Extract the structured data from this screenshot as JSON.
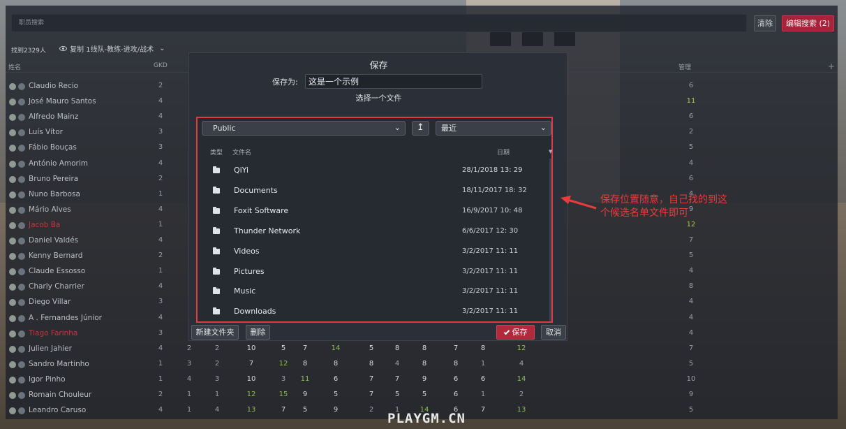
{
  "toolbar": {
    "search_placeholder": "职员搜索",
    "clear_label": "清除",
    "edit_search_label": "编辑搜索 (2)"
  },
  "results": {
    "found_text": "找到2329人",
    "view_label": "复制 1线队-教练-进攻/战术"
  },
  "table": {
    "col_name": "姓名",
    "col_gkd": "GKD",
    "col_manage": "管理",
    "rows": [
      {
        "name": "Claudio Recio",
        "color": "normal",
        "cells": [
          "2"
        ],
        "manage": "6",
        "manage_hl": false
      },
      {
        "name": "José Mauro Santos",
        "color": "normal",
        "cells": [
          "4"
        ],
        "manage": "11",
        "manage_hl": true
      },
      {
        "name": "Alfredo Mainz",
        "color": "normal",
        "cells": [
          "4"
        ],
        "manage": "6",
        "manage_hl": false
      },
      {
        "name": "Luís Vítor",
        "color": "normal",
        "cells": [
          "3"
        ],
        "manage": "2",
        "manage_hl": false
      },
      {
        "name": "Fábio Bouças",
        "color": "normal",
        "cells": [
          "3"
        ],
        "manage": "5",
        "manage_hl": false
      },
      {
        "name": "António Amorim",
        "color": "normal",
        "cells": [
          "4"
        ],
        "manage": "4",
        "manage_hl": false
      },
      {
        "name": "Bruno Pereira",
        "color": "normal",
        "cells": [
          "2"
        ],
        "manage": "6",
        "manage_hl": false
      },
      {
        "name": "Nuno Barbosa",
        "color": "normal",
        "cells": [
          "1"
        ],
        "manage": "4",
        "manage_hl": false
      },
      {
        "name": "Mário Alves",
        "color": "normal",
        "cells": [
          "4"
        ],
        "manage": "9",
        "manage_hl": false
      },
      {
        "name": "Jacob Ba",
        "color": "red",
        "cells": [
          "1"
        ],
        "manage": "12",
        "manage_hl": true
      },
      {
        "name": "Daniel Valdés",
        "color": "normal",
        "cells": [
          "4"
        ],
        "manage": "7",
        "manage_hl": false
      },
      {
        "name": "Kenny Bernard",
        "color": "normal",
        "cells": [
          "2"
        ],
        "manage": "5",
        "manage_hl": false
      },
      {
        "name": "Claude Essosso",
        "color": "normal",
        "cells": [
          "1"
        ],
        "manage": "4",
        "manage_hl": false
      },
      {
        "name": "Charly Charrier",
        "color": "normal",
        "cells": [
          "4"
        ],
        "manage": "8",
        "manage_hl": false
      },
      {
        "name": "Diego Villar",
        "color": "normal",
        "cells": [
          "3"
        ],
        "manage": "4",
        "manage_hl": false
      },
      {
        "name": "A . Fernandes Júnior",
        "color": "normal",
        "cells": [
          "4"
        ],
        "manage": "4",
        "manage_hl": false
      },
      {
        "name": "Tiago Farinha",
        "color": "red",
        "cells": [
          "3"
        ],
        "manage": "4",
        "manage_hl": false
      }
    ],
    "full_rows": [
      {
        "name": "Julien Jahier",
        "cells": [
          "4",
          "2",
          "2",
          "10",
          "5",
          "7",
          "14",
          "5",
          "8",
          "8",
          "7",
          "8",
          "12"
        ],
        "manage": "7"
      },
      {
        "name": "Sandro Martinho",
        "cells": [
          "1",
          "3",
          "2",
          "7",
          "12",
          "8",
          "8",
          "8",
          "4",
          "8",
          "8",
          "1",
          "4"
        ],
        "manage": "5"
      },
      {
        "name": "Igor Pinho",
        "cells": [
          "1",
          "4",
          "3",
          "10",
          "3",
          "11",
          "6",
          "7",
          "7",
          "9",
          "6",
          "6",
          "14"
        ],
        "manage": "10"
      },
      {
        "name": "Romain Chouleur",
        "cells": [
          "2",
          "1",
          "1",
          "12",
          "15",
          "9",
          "5",
          "7",
          "5",
          "5",
          "6",
          "1",
          "2"
        ],
        "manage": "9"
      },
      {
        "name": "Leandro Caruso",
        "cells": [
          "4",
          "1",
          "4",
          "13",
          "7",
          "5",
          "9",
          "2",
          "1",
          "14",
          "6",
          "7",
          "13"
        ],
        "manage": "5"
      }
    ]
  },
  "dialog": {
    "title": "保存",
    "save_as_label": "保存为:",
    "save_as_value": "这是一个示例",
    "choose_file": "选择一个文件",
    "location": "Public",
    "recent": "最近",
    "col_type": "类型",
    "col_filename": "文件名",
    "col_date": "日期",
    "files": [
      {
        "name": "QiYi",
        "date": "28/1/2018 13: 29"
      },
      {
        "name": "Documents",
        "date": "18/11/2017 18: 32"
      },
      {
        "name": "Foxit Software",
        "date": "16/9/2017 10: 48"
      },
      {
        "name": "Thunder Network",
        "date": "6/6/2017 12: 30"
      },
      {
        "name": "Videos",
        "date": "3/2/2017 11: 11"
      },
      {
        "name": "Pictures",
        "date": "3/2/2017 11: 11"
      },
      {
        "name": "Music",
        "date": "3/2/2017 11: 11"
      },
      {
        "name": "Downloads",
        "date": "3/2/2017 11: 11"
      }
    ],
    "new_folder_label": "新建文件夹",
    "delete_label": "删除",
    "save_label": "保存",
    "cancel_label": "取消"
  },
  "annotation": {
    "line1": "保存位置随意，自己找的到这",
    "line2": "个候选名单文件即可",
    "color": "#e73c3c"
  },
  "watermark": "PLAYGM.CN"
}
